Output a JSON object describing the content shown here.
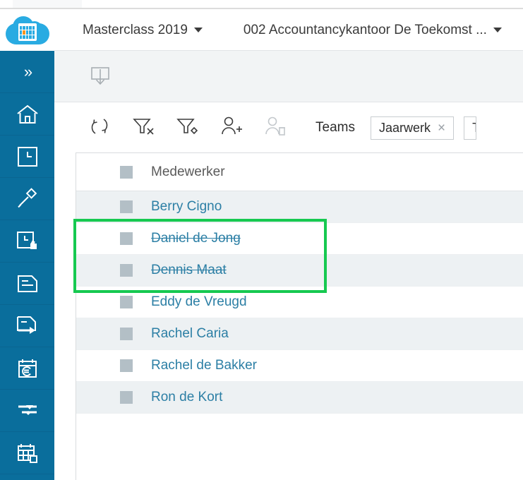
{
  "app": {
    "logo_name": "cloud-calendar-logo",
    "accent_color": "#29abe2",
    "logo_accent_cell_color": "#f7941e",
    "sidebar_color": "#0a6e9c",
    "link_color": "#2c7fa5",
    "highlight_color": "#16c950"
  },
  "appbar": {
    "breadcrumbs": [
      {
        "label": "Masterclass 2019",
        "has_dropdown": true
      },
      {
        "label": "002 Accountancykantoor De Toekomst ...",
        "has_dropdown": true
      }
    ]
  },
  "sidebar": {
    "items": [
      {
        "name": "collapse-expand",
        "icon": "chevron-double-right-icon",
        "label": "»"
      },
      {
        "name": "home",
        "icon": "home-icon"
      },
      {
        "name": "hours",
        "icon": "clock-square-icon"
      },
      {
        "name": "gavel",
        "icon": "gavel-icon"
      },
      {
        "name": "hours-approval",
        "icon": "clock-thumbsup-icon"
      },
      {
        "name": "documents",
        "icon": "document-icon"
      },
      {
        "name": "document-export",
        "icon": "document-arrow-right-icon"
      },
      {
        "name": "invoicing",
        "icon": "calendar-euro-icon"
      },
      {
        "name": "settings-sliders",
        "icon": "sliders-icon"
      },
      {
        "name": "planning",
        "icon": "calendar-grid-icon"
      }
    ]
  },
  "subbar": {
    "import_button": {
      "name": "import-button",
      "icon": "tray-download-icon"
    }
  },
  "toolbar": {
    "buttons": [
      {
        "name": "refresh-button",
        "icon": "refresh-icon",
        "enabled": true
      },
      {
        "name": "clear-filter-button",
        "icon": "filter-clear-icon",
        "enabled": true
      },
      {
        "name": "edit-filter-button",
        "icon": "filter-settings-icon",
        "enabled": true
      },
      {
        "name": "add-employee-button",
        "icon": "user-plus-icon",
        "enabled": true
      },
      {
        "name": "delete-employee-button",
        "icon": "user-delete-icon",
        "enabled": false
      }
    ],
    "teams_label": "Teams",
    "tags": [
      {
        "label": "Jaarwerk",
        "removable": true,
        "close_glyph": "×"
      },
      {
        "label": "T",
        "removable": true,
        "clipped": true
      }
    ]
  },
  "table": {
    "columns": [
      {
        "key": "medewerker",
        "label": "Medewerker"
      }
    ],
    "rows": [
      {
        "name": "Berry Cigno",
        "inactive": false,
        "striped": true
      },
      {
        "name": "Daniel de Jong",
        "inactive": true,
        "striped": false
      },
      {
        "name": "Dennis Maat",
        "inactive": true,
        "striped": true
      },
      {
        "name": "Eddy de Vreugd",
        "inactive": false,
        "striped": false
      },
      {
        "name": "Rachel Caria",
        "inactive": false,
        "striped": true
      },
      {
        "name": "Rachel de Bakker",
        "inactive": false,
        "striped": false
      },
      {
        "name": "Ron de Kort",
        "inactive": false,
        "striped": true
      }
    ]
  },
  "annotation": {
    "name": "highlight-box",
    "covers_rows": [
      "Daniel de Jong",
      "Dennis Maat"
    ],
    "color": "#16c950"
  }
}
